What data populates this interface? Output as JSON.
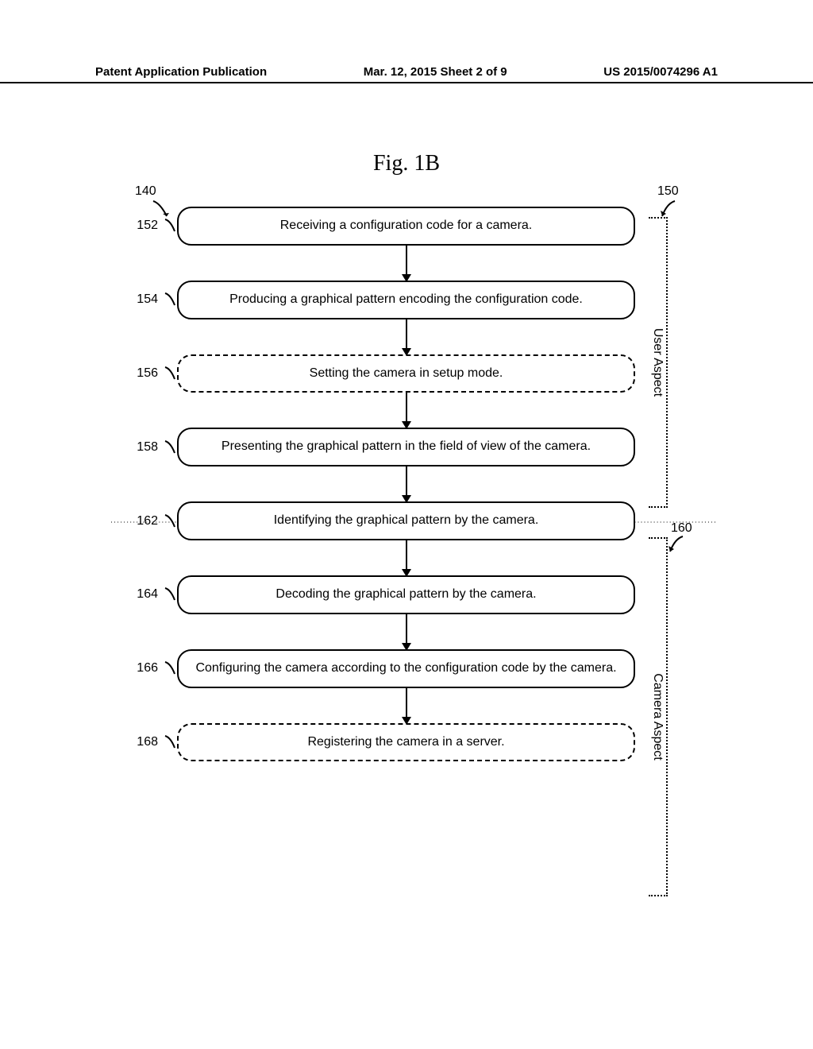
{
  "header": {
    "left": "Patent Application Publication",
    "center": "Mar. 12, 2015  Sheet 2 of 9",
    "right": "US 2015/0074296 A1"
  },
  "figure_title": "Fig. 1B",
  "refs": {
    "top_left": "140",
    "top_right": "150",
    "mid_right": "160"
  },
  "aspects": {
    "user": "User Aspect",
    "camera": "Camera Aspect"
  },
  "steps": [
    {
      "ref": "152",
      "text": "Receiving a configuration code for a camera.",
      "dashed": false
    },
    {
      "ref": "154",
      "text": "Producing a graphical pattern encoding the configuration code.",
      "dashed": false
    },
    {
      "ref": "156",
      "text": "Setting the camera in setup mode.",
      "dashed": true
    },
    {
      "ref": "158",
      "text": "Presenting the graphical pattern in the field of view of the camera.",
      "dashed": false
    },
    {
      "ref": "162",
      "text": "Identifying the graphical pattern by the camera.",
      "dashed": false
    },
    {
      "ref": "164",
      "text": "Decoding the graphical pattern by the camera.",
      "dashed": false
    },
    {
      "ref": "166",
      "text": "Configuring the camera according to the configuration code by the camera.",
      "dashed": false
    },
    {
      "ref": "168",
      "text": "Registering the camera in a server.",
      "dashed": true
    }
  ],
  "chart_data": {
    "type": "flowchart",
    "title": "Fig. 1B",
    "groups": [
      {
        "name": "User Aspect",
        "ref": "150",
        "steps": [
          "152",
          "154",
          "156",
          "158"
        ]
      },
      {
        "name": "Camera Aspect",
        "ref": "160",
        "steps": [
          "162",
          "164",
          "166",
          "168"
        ]
      }
    ],
    "start_ref": "140",
    "nodes": [
      {
        "id": "152",
        "label": "Receiving a configuration code for a camera.",
        "optional": false
      },
      {
        "id": "154",
        "label": "Producing a graphical pattern encoding the configuration code.",
        "optional": false
      },
      {
        "id": "156",
        "label": "Setting the camera in setup mode.",
        "optional": true
      },
      {
        "id": "158",
        "label": "Presenting the graphical pattern in the field of view of the camera.",
        "optional": false
      },
      {
        "id": "162",
        "label": "Identifying the graphical pattern by the camera.",
        "optional": false
      },
      {
        "id": "164",
        "label": "Decoding the graphical pattern by the camera.",
        "optional": false
      },
      {
        "id": "166",
        "label": "Configuring the camera according to the configuration code by the camera.",
        "optional": false
      },
      {
        "id": "168",
        "label": "Registering the camera in a server.",
        "optional": true
      }
    ],
    "edges": [
      [
        "152",
        "154"
      ],
      [
        "154",
        "156"
      ],
      [
        "156",
        "158"
      ],
      [
        "158",
        "162"
      ],
      [
        "162",
        "164"
      ],
      [
        "164",
        "166"
      ],
      [
        "166",
        "168"
      ]
    ]
  }
}
